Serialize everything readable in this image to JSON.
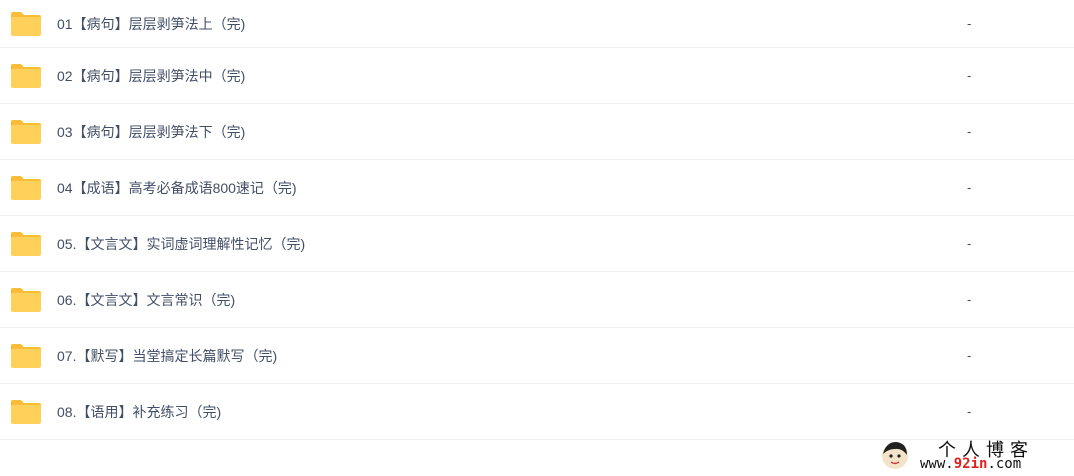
{
  "files": [
    {
      "name": "01【病句】层层剥笋法上（完)",
      "size": "-"
    },
    {
      "name": "02【病句】层层剥笋法中（完)",
      "size": "-"
    },
    {
      "name": "03【病句】层层剥笋法下（完)",
      "size": "-"
    },
    {
      "name": "04【成语】高考必备成语800速记（完)",
      "size": "-"
    },
    {
      "name": "05.【文言文】实词虚词理解性记忆（完)",
      "size": "-"
    },
    {
      "name": "06.【文言文】文言常识（完)",
      "size": "-"
    },
    {
      "name": "07.【默写】当堂搞定长篇默写（完)",
      "size": "-"
    },
    {
      "name": "08.【语用】补充练习（完)",
      "size": "-"
    }
  ],
  "watermark": {
    "title": "个人博客",
    "url_prefix": "www.",
    "url_highlight": "92in",
    "url_suffix": ".com"
  },
  "colors": {
    "folder": "#ffd15b",
    "folder_tab": "#f9bd3a",
    "text": "#424e67",
    "divider": "#eef0f4"
  }
}
